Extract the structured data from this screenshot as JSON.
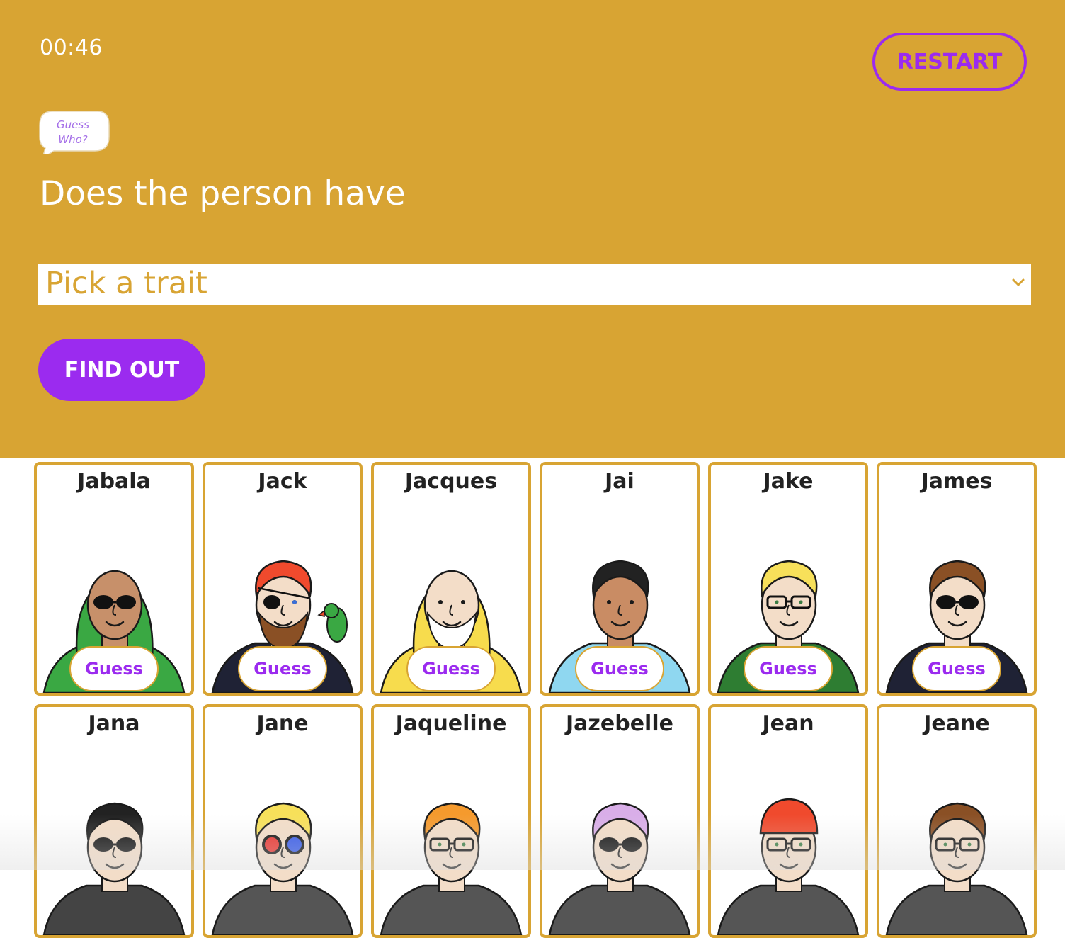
{
  "timer": "00:46",
  "restart_label": "RESTART",
  "logo_text": [
    "Guess",
    "Who?"
  ],
  "question": "Does the person have",
  "trait_select": {
    "value": "Pick a trait"
  },
  "find_out_label": "FIND OUT",
  "guess_label": "Guess",
  "colors": {
    "header": "#d8a433",
    "accent": "#9b2bef",
    "card_border": "#d8a433"
  },
  "cards": [
    {
      "name": "Jabala",
      "skin": "#c7906a",
      "hair": "#3aa843",
      "shirt": "#3aa843",
      "hood": true,
      "glasses": "sunglasses"
    },
    {
      "name": "Jack",
      "skin": "#f3ddc8",
      "hair": "#f04a2d",
      "shirt": "#1f2235",
      "beard": "#8a5025",
      "eyepatch": true,
      "parrot": true
    },
    {
      "name": "Jacques",
      "skin": "#f3ddc8",
      "hair": "#f7dc4d",
      "shirt": "#f7dc4d",
      "hood": true,
      "beard": "#ffffff"
    },
    {
      "name": "Jai",
      "skin": "#c98c64",
      "hair": "#222222",
      "shirt": "#8fd7f0"
    },
    {
      "name": "Jake",
      "skin": "#f3ddc8",
      "hair": "#f7e05a",
      "shirt": "#2e7d32",
      "glasses": "clear"
    },
    {
      "name": "James",
      "skin": "#f3ddc8",
      "hair": "#8a5025",
      "shirt": "#1f2235",
      "glasses": "sunglasses"
    },
    {
      "name": "Jana",
      "skin": "#f3ddc8",
      "hair": "#222222",
      "shirt": "#444444",
      "glasses": "sunglasses"
    },
    {
      "name": "Jane",
      "skin": "#f3ddc8",
      "hair": "#f7e05a",
      "shirt": "#555555",
      "glasses": "3d"
    },
    {
      "name": "Jaqueline",
      "skin": "#f3ddc8",
      "hair": "#f59a2d",
      "shirt": "#555555",
      "glasses": "clear"
    },
    {
      "name": "Jazebelle",
      "skin": "#f3ddc8",
      "hair": "#d9aee8",
      "shirt": "#555555",
      "glasses": "round-dark"
    },
    {
      "name": "Jean",
      "skin": "#f3ddc8",
      "hair": "#f04a2d",
      "shirt": "#555555",
      "glasses": "clear",
      "beanie": true
    },
    {
      "name": "Jeane",
      "skin": "#f3ddc8",
      "hair": "#8a5025",
      "shirt": "#555555",
      "glasses": "clear"
    }
  ]
}
